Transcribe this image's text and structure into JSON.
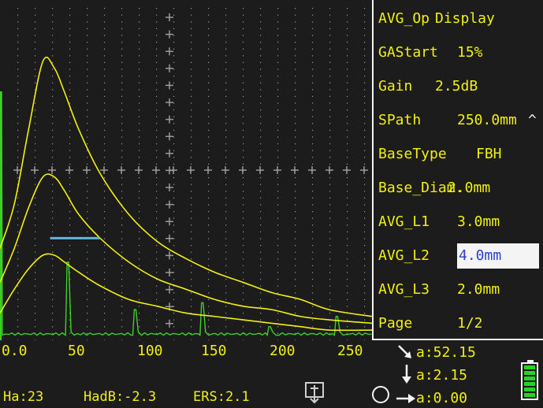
{
  "panel": {
    "rows": [
      {
        "label": "AVG_Op",
        "value": "Display"
      },
      {
        "label": "GAStart",
        "value": "15%"
      },
      {
        "label": "Gain",
        "value": "2.5dB"
      },
      {
        "label": "SPath",
        "value": "250.0mm",
        "arrow": "^"
      },
      {
        "label": "BaseType",
        "value": "FBH"
      },
      {
        "label": "Base_Diam.",
        "value": "2.0mm"
      },
      {
        "label": "AVG_L1",
        "value": "3.0mm"
      },
      {
        "label": "AVG_L2",
        "value": "4.0mm",
        "selected": true
      },
      {
        "label": "AVG_L3",
        "value": "2.0mm"
      },
      {
        "label": "Page",
        "value": "1/2"
      }
    ]
  },
  "axis": {
    "ticks": [
      "0.0",
      "50",
      "100",
      "150",
      "200",
      "250"
    ]
  },
  "status": {
    "ha": "Ha:23",
    "hadb": "HadB:-2.3",
    "ers": "ERS:2.1"
  },
  "readouts": {
    "sound_path": "a:52.15",
    "depth": "a:2.15",
    "surface": "a:0.00"
  },
  "colors": {
    "trace": "#f0f010",
    "echo": "#3fcf2a",
    "gate": "#5ab8d8",
    "background": "#1c1c1c",
    "grid": "#9a9a9a"
  },
  "battery_level": 1.0,
  "chart_data": {
    "type": "line",
    "xlim": [
      0,
      260
    ],
    "ylim": [
      0,
      100
    ],
    "grid": true,
    "series": [
      {
        "role": "avg_curve",
        "x": [
          0,
          10,
          20,
          30,
          38,
          45,
          55,
          70,
          90,
          110,
          130,
          150,
          170,
          190,
          210,
          230,
          260
        ],
        "y": [
          27,
          40,
          62,
          82,
          80,
          73,
          62,
          49,
          37,
          29,
          24,
          20,
          17,
          14,
          12,
          9,
          7
        ]
      },
      {
        "role": "avg_curve",
        "x": [
          0,
          10,
          20,
          30,
          38,
          45,
          55,
          70,
          90,
          110,
          130,
          150,
          170,
          190,
          210,
          230,
          260
        ],
        "y": [
          17,
          27,
          39,
          48,
          48,
          44,
          37,
          30,
          23,
          18,
          15,
          12,
          10,
          9,
          7,
          6,
          5
        ]
      },
      {
        "role": "avg_curve",
        "x": [
          0,
          10,
          20,
          30,
          38,
          45,
          55,
          70,
          90,
          110,
          130,
          150,
          170,
          190,
          210,
          230,
          260
        ],
        "y": [
          8,
          15,
          21,
          25,
          25,
          23,
          20,
          16,
          12,
          10,
          8,
          7,
          6,
          5,
          4,
          3,
          3
        ]
      },
      {
        "role": "a_scan",
        "echoes": [
          {
            "x": 0,
            "y": 73
          },
          {
            "x": 48,
            "y": 23
          },
          {
            "x": 95,
            "y": 9
          },
          {
            "x": 142,
            "y": 11
          },
          {
            "x": 189,
            "y": 4
          },
          {
            "x": 236,
            "y": 7
          }
        ]
      }
    ],
    "gate": {
      "start": 35,
      "end": 70,
      "level": 30
    }
  }
}
